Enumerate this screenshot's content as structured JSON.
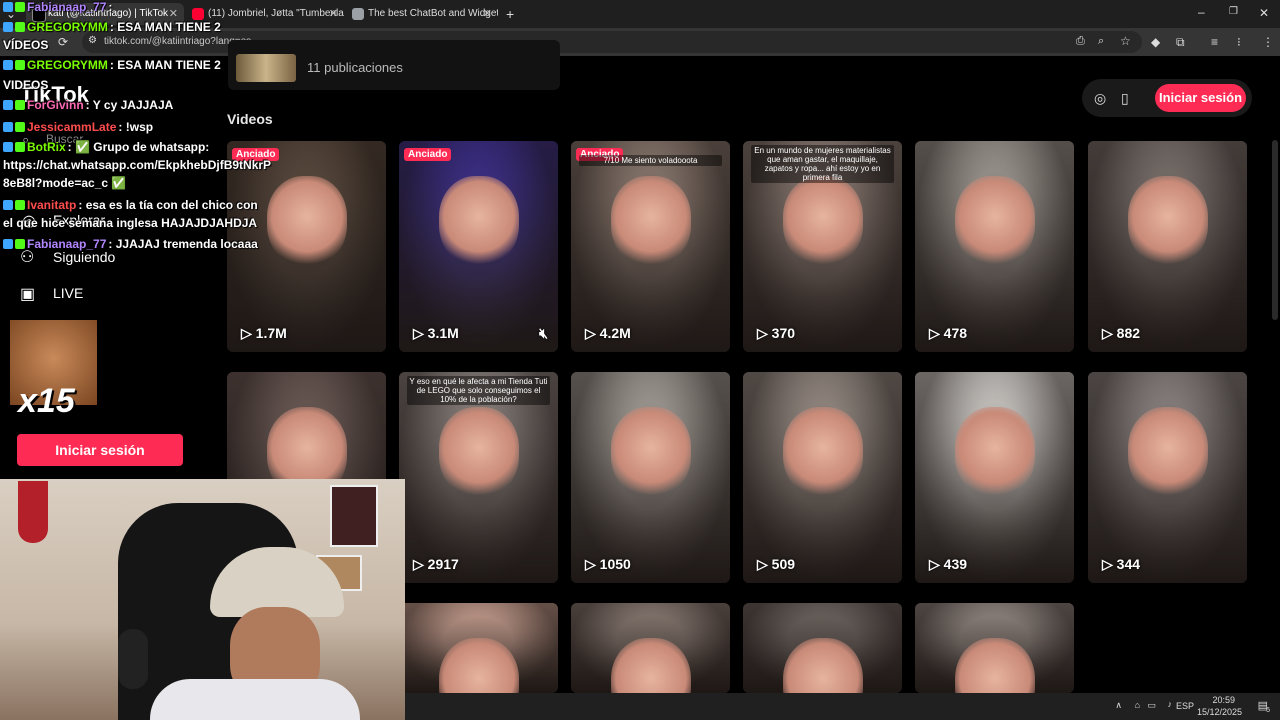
{
  "browser": {
    "tabs": [
      {
        "label": "kati (@katiintriago) | TikTok",
        "color": "#ffffff",
        "active": true
      },
      {
        "label": "(11) Jombriel, Jøtta \"Tumbenla\"",
        "color": "#ff0033",
        "active": false
      },
      {
        "label": "The best ChatBot and Widgets",
        "color": "#9aa0a6",
        "active": false
      }
    ],
    "new_tab_icon": "plus-icon",
    "url": "tiktok.com/@katiintriago?lang=es"
  },
  "profile": {
    "publicaciones": "11 publicaciones",
    "videos_title": "Videos",
    "login_label": "Iniciar sesión"
  },
  "sidebar": {
    "logo": "TikTok",
    "search_placeholder": "Buscar",
    "items": [
      {
        "label": "Explorar",
        "icon": "compass-icon"
      },
      {
        "label": "Siguiendo",
        "icon": "people-icon"
      },
      {
        "label": "LIVE",
        "icon": "live-tv-icon"
      }
    ],
    "login_label": "Iniciar sesión",
    "emote_text": "x15"
  },
  "videos": [
    {
      "views": "1.7M",
      "pinned": "Anciado",
      "bg": "#5a4a3e",
      "caption": ""
    },
    {
      "views": "3.1M",
      "pinned": "Anciado",
      "bg": "#3b2e8c",
      "caption": ""
    },
    {
      "views": "4.2M",
      "pinned": "Anciado",
      "bg": "#8d7c72",
      "caption": "7/10 Me siento voladooota"
    },
    {
      "views": "370",
      "pinned": "",
      "bg": "#8f7f78",
      "caption": "En un mundo de mujeres materialistas que aman gastar, el maquillaje, zapatos y ropa... ahí estoy yo en primera fila"
    },
    {
      "views": "478",
      "pinned": "",
      "bg": "#a49e98",
      "caption": ""
    },
    {
      "views": "882",
      "pinned": "",
      "bg": "#7d7470",
      "caption": ""
    },
    {
      "views": "",
      "pinned": "",
      "bg": "#6d5c57",
      "caption": ""
    },
    {
      "views": "2917",
      "pinned": "",
      "bg": "#8d8480",
      "caption": "Y eso en qué le afecta a mi Tienda Tuti de LEGO que solo conseguimos el 10% de la población?"
    },
    {
      "views": "1050",
      "pinned": "",
      "bg": "#a9a39d",
      "caption": ""
    },
    {
      "views": "509",
      "pinned": "",
      "bg": "#9b9089",
      "caption": ""
    },
    {
      "views": "439",
      "pinned": "",
      "bg": "#d5d2ce",
      "caption": ""
    },
    {
      "views": "344",
      "pinned": "",
      "bg": "#8f8886",
      "caption": ""
    },
    {
      "views": "",
      "pinned": "",
      "bg": "#a8a39a",
      "caption": ""
    },
    {
      "views": "",
      "pinned": "",
      "bg": "#c8a090",
      "caption": ""
    },
    {
      "views": "",
      "pinned": "",
      "bg": "#8a7b74",
      "caption": ""
    },
    {
      "views": "",
      "pinned": "",
      "bg": "#6f6662",
      "caption": ""
    },
    {
      "views": "",
      "pinned": "",
      "bg": "#938984",
      "caption": ""
    }
  ],
  "chat": [
    {
      "user": "Fabianaap_77",
      "color": "#b286ff",
      "msg": ""
    },
    {
      "user": "GREGORYMM",
      "color": "#7cfc00",
      "msg": "ESA MAN TIENE 2"
    },
    {
      "user": "",
      "color": "#ffffff",
      "msg": "VÍDEOS"
    },
    {
      "user": "GREGORYMM",
      "color": "#7cfc00",
      "msg": "ESA MAN TIENE 2"
    },
    {
      "user": "",
      "color": "#ffffff",
      "msg": "VIDEOS"
    },
    {
      "user": "ForGivinn",
      "color": "#ff69b4",
      "msg": "Y cy JAJJAJA"
    },
    {
      "user": "JessicammLate",
      "color": "#ff4d4d",
      "msg": "!wsp"
    },
    {
      "user": "BotRix",
      "color": "#7cfc00",
      "msg": "✅ Grupo de whatsapp:"
    },
    {
      "user": "",
      "color": "#ffffff",
      "msg": "https://chat.whatsapp.com/EkpkhebDjfB9tNkrP"
    },
    {
      "user": "",
      "color": "#ffffff",
      "msg": "8eB8l?mode=ac_c ✅"
    },
    {
      "user": "Ivanitatp",
      "color": "#ff4d4d",
      "msg": "esa es la tía con del chico con"
    },
    {
      "user": "",
      "color": "#ffffff",
      "msg": "el que hice semana inglesa HAJAJDJAHDJA"
    },
    {
      "user": "Fabianaap_77",
      "color": "#b286ff",
      "msg": "JJAJAJ tremenda locaaa"
    }
  ],
  "taskbar": {
    "lang": "ESP",
    "time": "20:59",
    "date": "15/12/2025",
    "notif": "5"
  }
}
